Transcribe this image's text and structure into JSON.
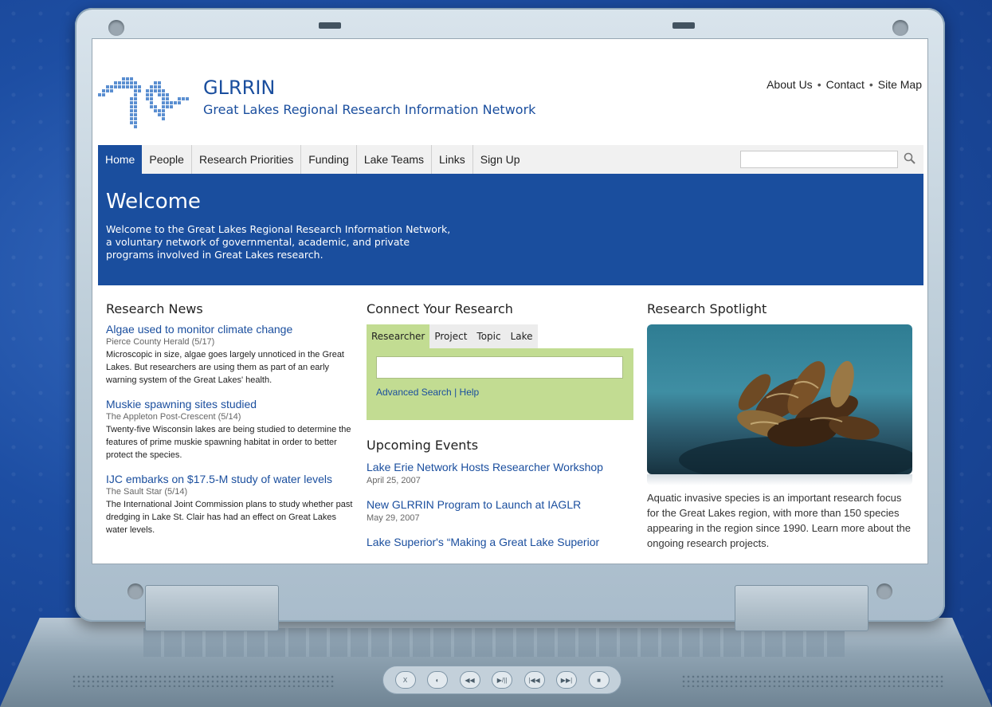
{
  "site": {
    "name": "GLRRIN",
    "subtitle": "Great Lakes Regional Research Information Network"
  },
  "util_links": [
    "About Us",
    "Contact",
    "Site Map"
  ],
  "nav": {
    "items": [
      "Home",
      "People",
      "Research Priorities",
      "Funding",
      "Lake Teams",
      "Links",
      "Sign Up"
    ],
    "active": "Home",
    "search_value": ""
  },
  "welcome": {
    "title": "Welcome",
    "text": "Welcome to the Great Lakes Regional Research Information Network, a voluntary network of governmental, academic, and private programs involved in Great Lakes research."
  },
  "news": {
    "heading": "Research News",
    "items": [
      {
        "title": "Algae used to monitor climate change",
        "source": "Pierce County Herald (5/17)",
        "body": "Microscopic in size, algae goes largely unnoticed in the Great Lakes. But researchers are using them as part of an early warning system of the Great Lakes' health."
      },
      {
        "title": "Muskie spawning sites studied",
        "source": "The Appleton Post-Crescent (5/14)",
        "body": "Twenty-five Wisconsin lakes are being studied to determine the features of prime muskie spawning habitat in order to better protect the species."
      },
      {
        "title": "IJC embarks on $17.5-M study of water levels",
        "source": "The Sault Star (5/14)",
        "body": "The International Joint Commission plans to study whether past dredging in Lake St. Clair has had an effect on Great Lakes water levels."
      }
    ]
  },
  "connect": {
    "heading": "Connect Your Research",
    "tabs": [
      "Researcher",
      "Project",
      "Topic",
      "Lake"
    ],
    "active_tab": "Researcher",
    "search_value": "",
    "advanced": "Advanced Search",
    "help": "Help"
  },
  "events": {
    "heading": "Upcoming Events",
    "items": [
      {
        "title": "Lake Erie Network Hosts Researcher Workshop",
        "date": "April 25, 2007"
      },
      {
        "title": "New GLRRIN Program to Launch at IAGLR",
        "date": "May 29, 2007"
      },
      {
        "title": "Lake Superior's “Making a Great Lake Superior",
        "date": ""
      }
    ]
  },
  "spotlight": {
    "heading": "Research Spotlight",
    "text": "Aquatic invasive species is an important research focus for the Great Lakes region, with more than 150 species appearing in the region since 1990. Learn more about the ongoing research projects."
  },
  "media_buttons": [
    "X",
    "◐",
    "◀◀",
    "▶/||",
    "|◀◀",
    "▶▶|",
    "■"
  ],
  "colors": {
    "brand_blue": "#1a4e9e",
    "connect_green": "#c2dc92",
    "background_blue": "#1d4ea3"
  }
}
